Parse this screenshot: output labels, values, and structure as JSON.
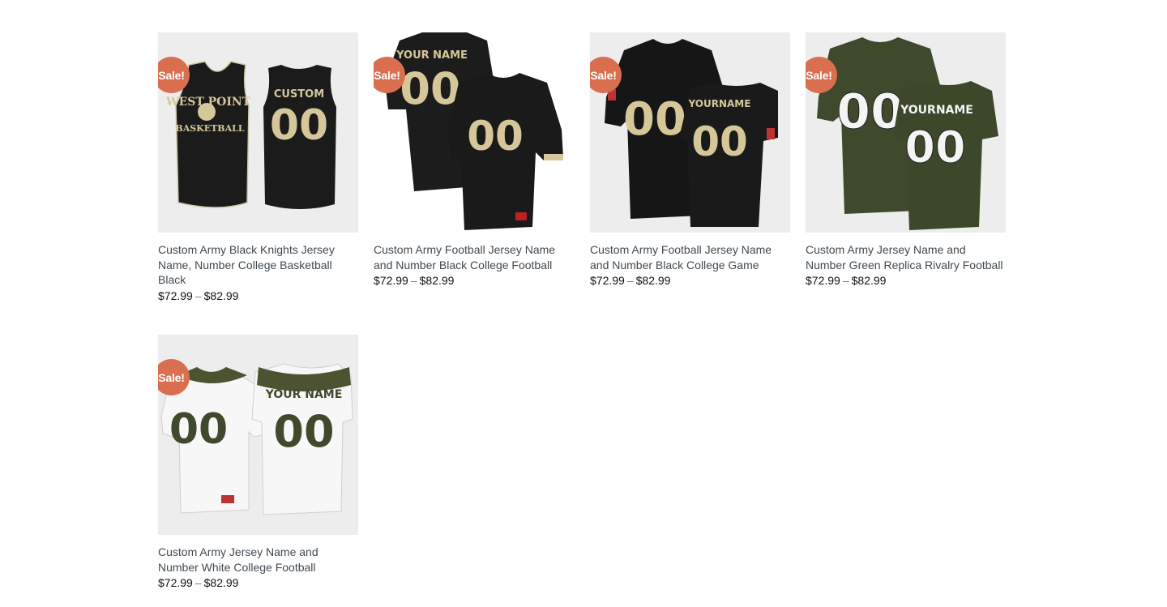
{
  "sale_badge": "Sale!",
  "price_separator": "–",
  "products": [
    {
      "title": "Custom Army Black Knights Jersey Name, Number College Basketball Black",
      "price_min": "$72.99",
      "price_max": "$82.99",
      "image": {
        "front_text": "WEST POINT",
        "front_text2": "BASKETBALL",
        "back_text": "CUSTOM",
        "number": "00"
      }
    },
    {
      "title": "Custom Army Football Jersey Name and Number Black College Football",
      "price_min": "$72.99",
      "price_max": "$82.99",
      "image": {
        "back_text": "YOUR NAME",
        "number": "00"
      }
    },
    {
      "title": "Custom Army Football Jersey Name and Number Black College Game",
      "price_min": "$72.99",
      "price_max": "$82.99",
      "image": {
        "back_text": "YOURNAME",
        "number": "00"
      }
    },
    {
      "title": "Custom Army Jersey Name and Number Green Replica Rivalry Football",
      "price_min": "$72.99",
      "price_max": "$82.99",
      "image": {
        "back_text": "YOURNAME",
        "number": "00"
      }
    },
    {
      "title": "Custom Army Jersey Name and Number White College Football",
      "price_min": "$72.99",
      "price_max": "$82.99",
      "image": {
        "back_text": "YOUR NAME",
        "number": "00"
      }
    }
  ],
  "colors": {
    "sale_badge": "#d96f4f",
    "thumb_bg": "#ededed",
    "gold": "#d6c79a",
    "army_green": "#3f4a2c"
  }
}
